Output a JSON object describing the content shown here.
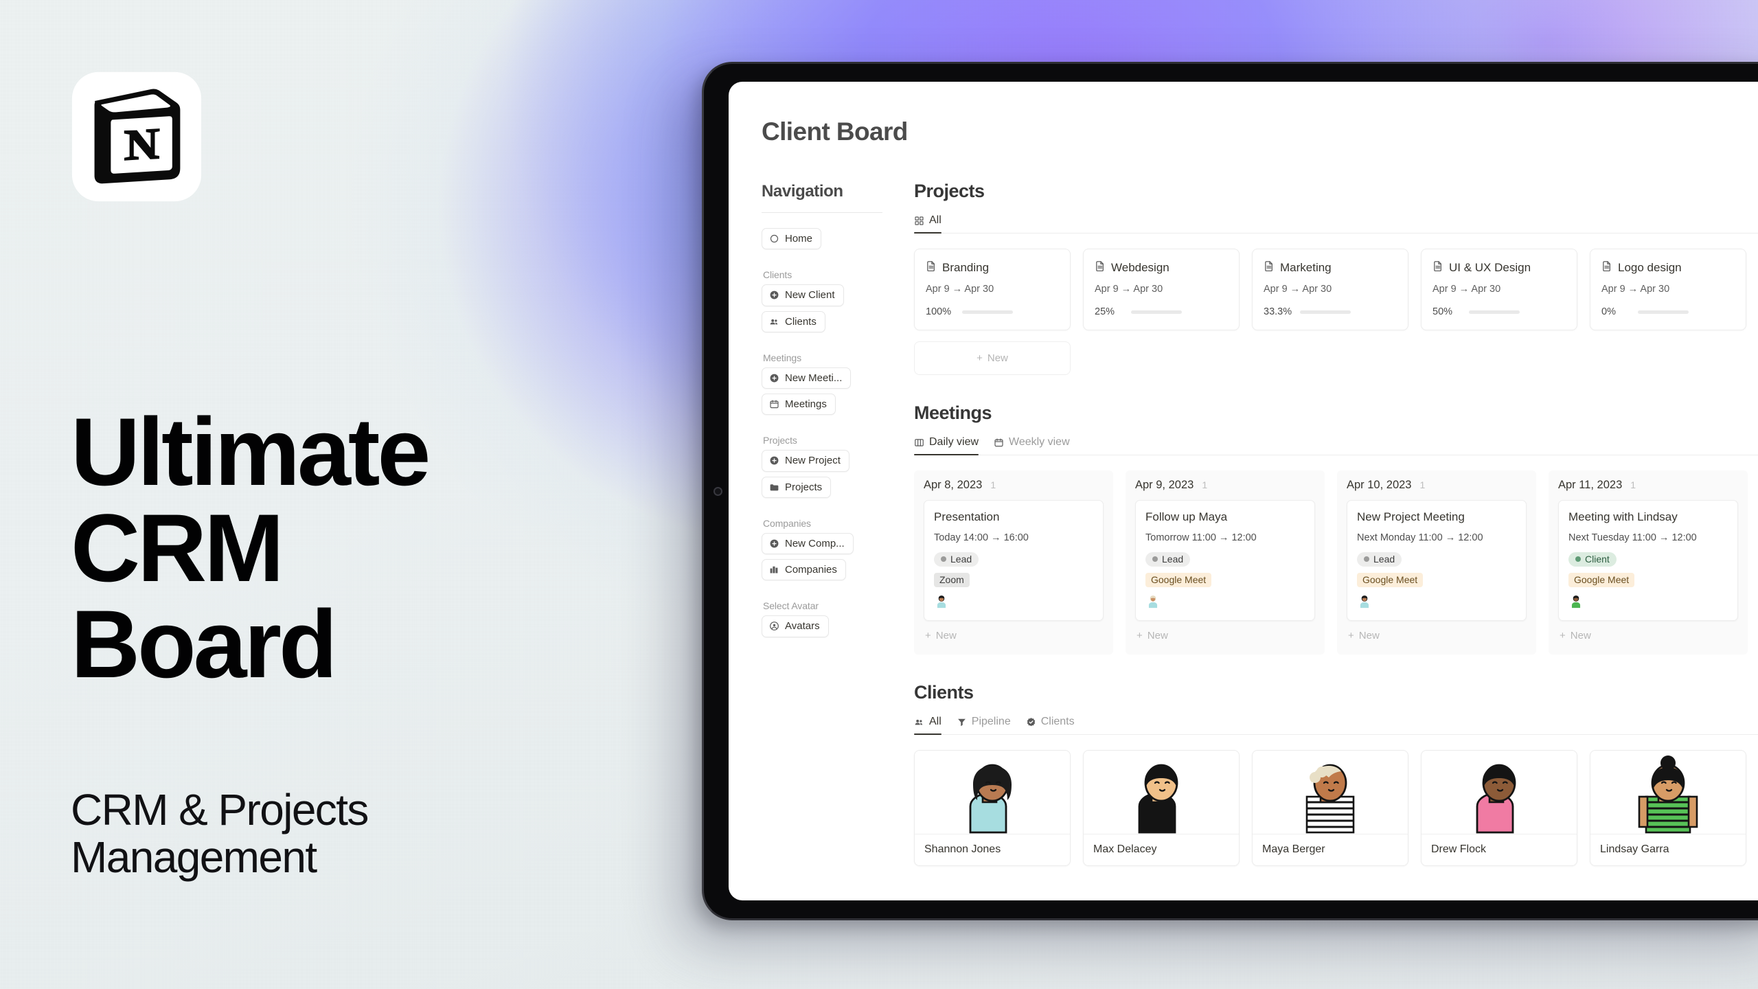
{
  "hero": {
    "logo_icon": "notion-logo-icon",
    "title": "Ultimate\nCRM\nBoard",
    "subtitle": "CRM & Projects\nManagement"
  },
  "device": {
    "type": "tablet"
  },
  "board": {
    "title": "Client Board"
  },
  "sidebar": {
    "heading": "Navigation",
    "groups": [
      {
        "label": "",
        "items": [
          {
            "label": "Home",
            "icon": "circle-icon"
          }
        ]
      },
      {
        "label": "Clients",
        "items": [
          {
            "label": "New Client",
            "icon": "plus-circle-icon"
          },
          {
            "label": "Clients",
            "icon": "people-icon"
          }
        ]
      },
      {
        "label": "Meetings",
        "items": [
          {
            "label": "New Meeti...",
            "icon": "plus-circle-icon"
          },
          {
            "label": "Meetings",
            "icon": "calendar-icon"
          }
        ]
      },
      {
        "label": "Projects",
        "items": [
          {
            "label": "New Project",
            "icon": "plus-circle-icon"
          },
          {
            "label": "Projects",
            "icon": "folder-icon"
          }
        ]
      },
      {
        "label": "Companies",
        "items": [
          {
            "label": "New Comp...",
            "icon": "plus-circle-icon"
          },
          {
            "label": "Companies",
            "icon": "building-icon"
          }
        ]
      },
      {
        "label": "Select Avatar",
        "items": [
          {
            "label": "Avatars",
            "icon": "user-circle-icon"
          }
        ]
      }
    ]
  },
  "projects": {
    "title": "Projects",
    "tabs": [
      {
        "label": "All",
        "icon": "grid-icon",
        "active": true
      }
    ],
    "new_label": "New",
    "new_icon": "plus-icon",
    "progress_color": "#7d9e91",
    "cards": [
      {
        "name": "Branding",
        "icon": "page-icon",
        "date": "Apr 9 → Apr 30",
        "percent_label": "100%",
        "percent": 100
      },
      {
        "name": "Webdesign",
        "icon": "page-icon",
        "date": "Apr 9 → Apr 30",
        "percent_label": "25%",
        "percent": 25
      },
      {
        "name": "Marketing",
        "icon": "page-icon",
        "date": "Apr 9 → Apr 30",
        "percent_label": "33.3%",
        "percent": 33.3
      },
      {
        "name": "UI & UX Design",
        "icon": "page-icon",
        "date": "Apr 9 → Apr 30",
        "percent_label": "50%",
        "percent": 50
      },
      {
        "name": "Logo design",
        "icon": "page-icon",
        "date": "Apr 9 → Apr 30",
        "percent_label": "0%",
        "percent": 0
      }
    ]
  },
  "meetings": {
    "title": "Meetings",
    "tabs": [
      {
        "label": "Daily view",
        "icon": "board-icon",
        "active": true
      },
      {
        "label": "Weekly view",
        "icon": "calendar-icon",
        "active": false
      }
    ],
    "new_label": "New",
    "new_icon": "plus-icon",
    "columns": [
      {
        "date": "Apr 8, 2023",
        "count": "1",
        "card": {
          "name": "Presentation",
          "time": "Today 14:00 → 16:00",
          "status": "Lead",
          "status_kind": "lead",
          "platform": "Zoom",
          "platform_kind": "zoom",
          "avatar": "avatar-person-mug"
        }
      },
      {
        "date": "Apr 9, 2023",
        "count": "1",
        "card": {
          "name": "Follow up Maya",
          "time": "Tomorrow 11:00 → 12:00",
          "status": "Lead",
          "status_kind": "lead",
          "platform": "Google Meet",
          "platform_kind": "gmeet",
          "avatar": "avatar-person-blonde"
        }
      },
      {
        "date": "Apr 10, 2023",
        "count": "1",
        "card": {
          "name": "New Project Meeting",
          "time": "Next Monday 11:00 → 12:00",
          "status": "Lead",
          "status_kind": "lead",
          "platform": "Google Meet",
          "platform_kind": "gmeet",
          "avatar": "avatar-person-mug"
        }
      },
      {
        "date": "Apr 11, 2023",
        "count": "1",
        "card": {
          "name": "Meeting with Lindsay",
          "time": "Next Tuesday 11:00 → 12:00",
          "status": "Client",
          "status_kind": "client",
          "platform": "Google Meet",
          "platform_kind": "gmeet",
          "avatar": "avatar-person-green"
        }
      }
    ]
  },
  "clients": {
    "title": "Clients",
    "tabs": [
      {
        "label": "All",
        "icon": "people-icon",
        "active": true
      },
      {
        "label": "Pipeline",
        "icon": "funnel-icon",
        "active": false
      },
      {
        "label": "Clients",
        "icon": "badge-icon",
        "active": false
      }
    ],
    "cards": [
      {
        "name": "Shannon Jones",
        "avatar": "client-shannon"
      },
      {
        "name": "Max Delacey",
        "avatar": "client-max"
      },
      {
        "name": "Maya Berger",
        "avatar": "client-maya"
      },
      {
        "name": "Drew Flock",
        "avatar": "client-drew"
      },
      {
        "name": "Lindsay Garra",
        "avatar": "client-lindsay"
      }
    ]
  }
}
